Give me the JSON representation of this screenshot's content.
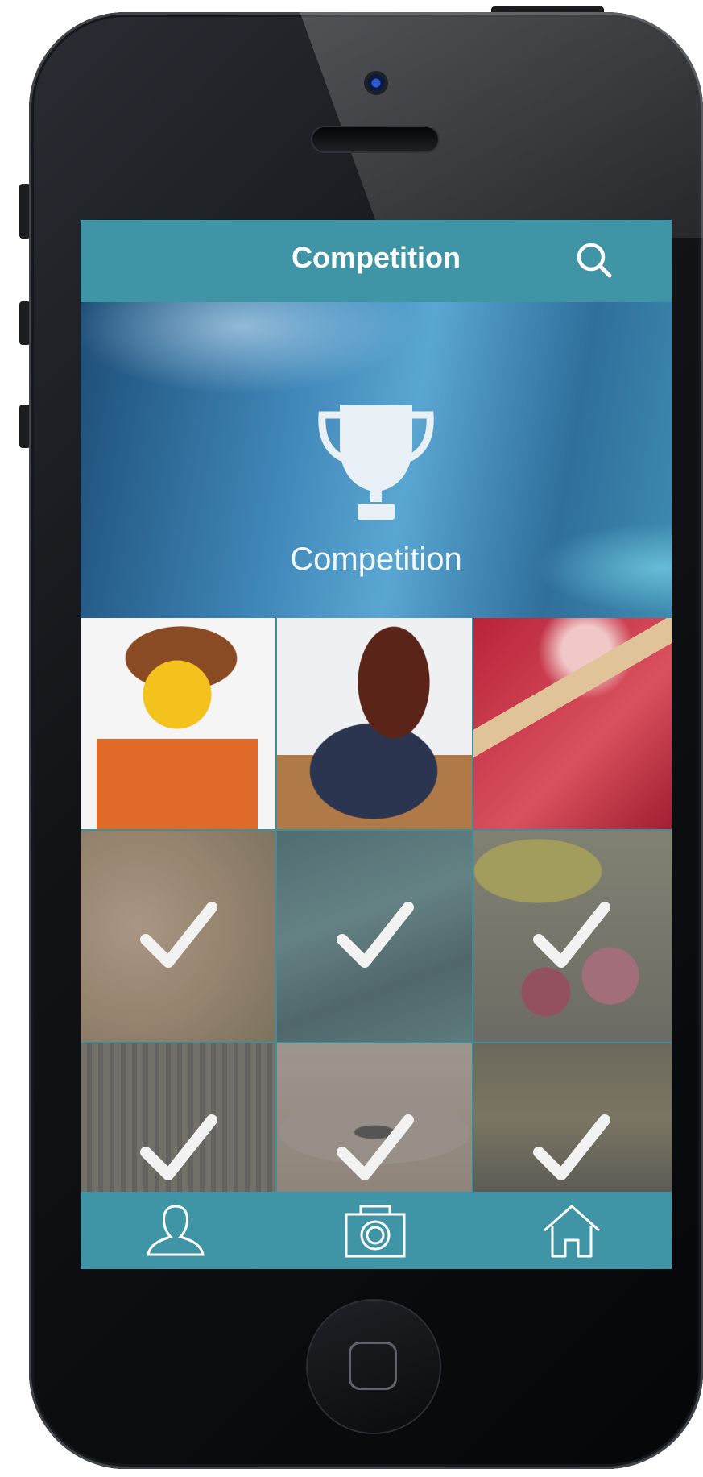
{
  "header": {
    "title": "Competition"
  },
  "hero": {
    "label": "Competition"
  },
  "grid": {
    "tiles": [
      {
        "subject": "lego-figure-photo",
        "completed": false
      },
      {
        "subject": "girl-with-phone-photo",
        "completed": false
      },
      {
        "subject": "red-pencil-drawing-photo",
        "completed": false
      },
      {
        "subject": "flower-photo",
        "completed": true
      },
      {
        "subject": "water-photo",
        "completed": true
      },
      {
        "subject": "fruit-basket-photo",
        "completed": true
      },
      {
        "subject": "building-photo",
        "completed": true
      },
      {
        "subject": "eye-photo",
        "completed": true
      },
      {
        "subject": "feet-photo",
        "completed": true
      }
    ]
  },
  "tabbar": {
    "icons": [
      "person-icon",
      "camera-icon",
      "home-icon"
    ]
  },
  "colors": {
    "accent": "#3f95a6",
    "check": "#f2f2f2"
  }
}
